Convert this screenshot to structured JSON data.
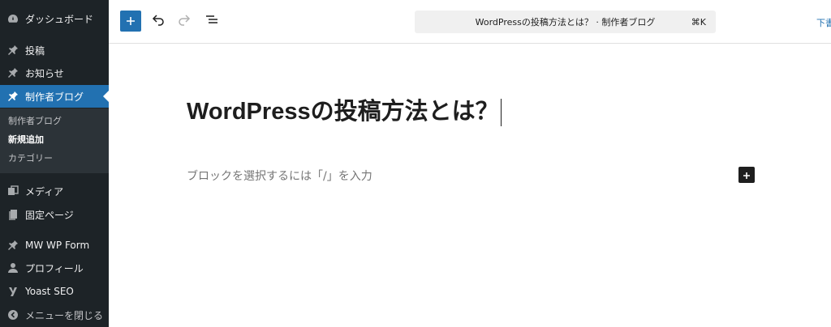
{
  "sidebar": {
    "items": [
      {
        "label": "ダッシュボード",
        "icon": "dashboard-icon"
      },
      {
        "label": "投稿",
        "icon": "pin-icon"
      },
      {
        "label": "お知らせ",
        "icon": "pin-icon"
      },
      {
        "label": "制作者ブログ",
        "icon": "pin-icon",
        "active": true
      },
      {
        "label": "メディア",
        "icon": "media-icon"
      },
      {
        "label": "固定ページ",
        "icon": "pages-icon"
      },
      {
        "label": "MW WP Form",
        "icon": "pin-icon"
      },
      {
        "label": "プロフィール",
        "icon": "user-icon"
      },
      {
        "label": "Yoast SEO",
        "icon": "yoast-icon"
      },
      {
        "label": "メニューを閉じる",
        "icon": "collapse-icon"
      }
    ],
    "submenu": [
      {
        "label": "制作者ブログ"
      },
      {
        "label": "新規追加",
        "current": true
      },
      {
        "label": "カテゴリー"
      }
    ]
  },
  "toolbar": {
    "add_block_icon": "plus-icon",
    "undo_icon": "undo-icon",
    "redo_icon": "redo-icon",
    "list_view_icon": "list-view-icon",
    "command_title": "WordPressの投稿方法とは？ · 制作者ブログ",
    "command_shortcut": "⌘K",
    "draft_label": "下書き"
  },
  "editor": {
    "post_title": "WordPressの投稿方法とは？",
    "block_placeholder": "ブロックを選択するには「/」を入力"
  },
  "colors": {
    "sidebar_bg": "#1d2327",
    "accent": "#2271b1",
    "submenu_bg": "#2c3338"
  }
}
